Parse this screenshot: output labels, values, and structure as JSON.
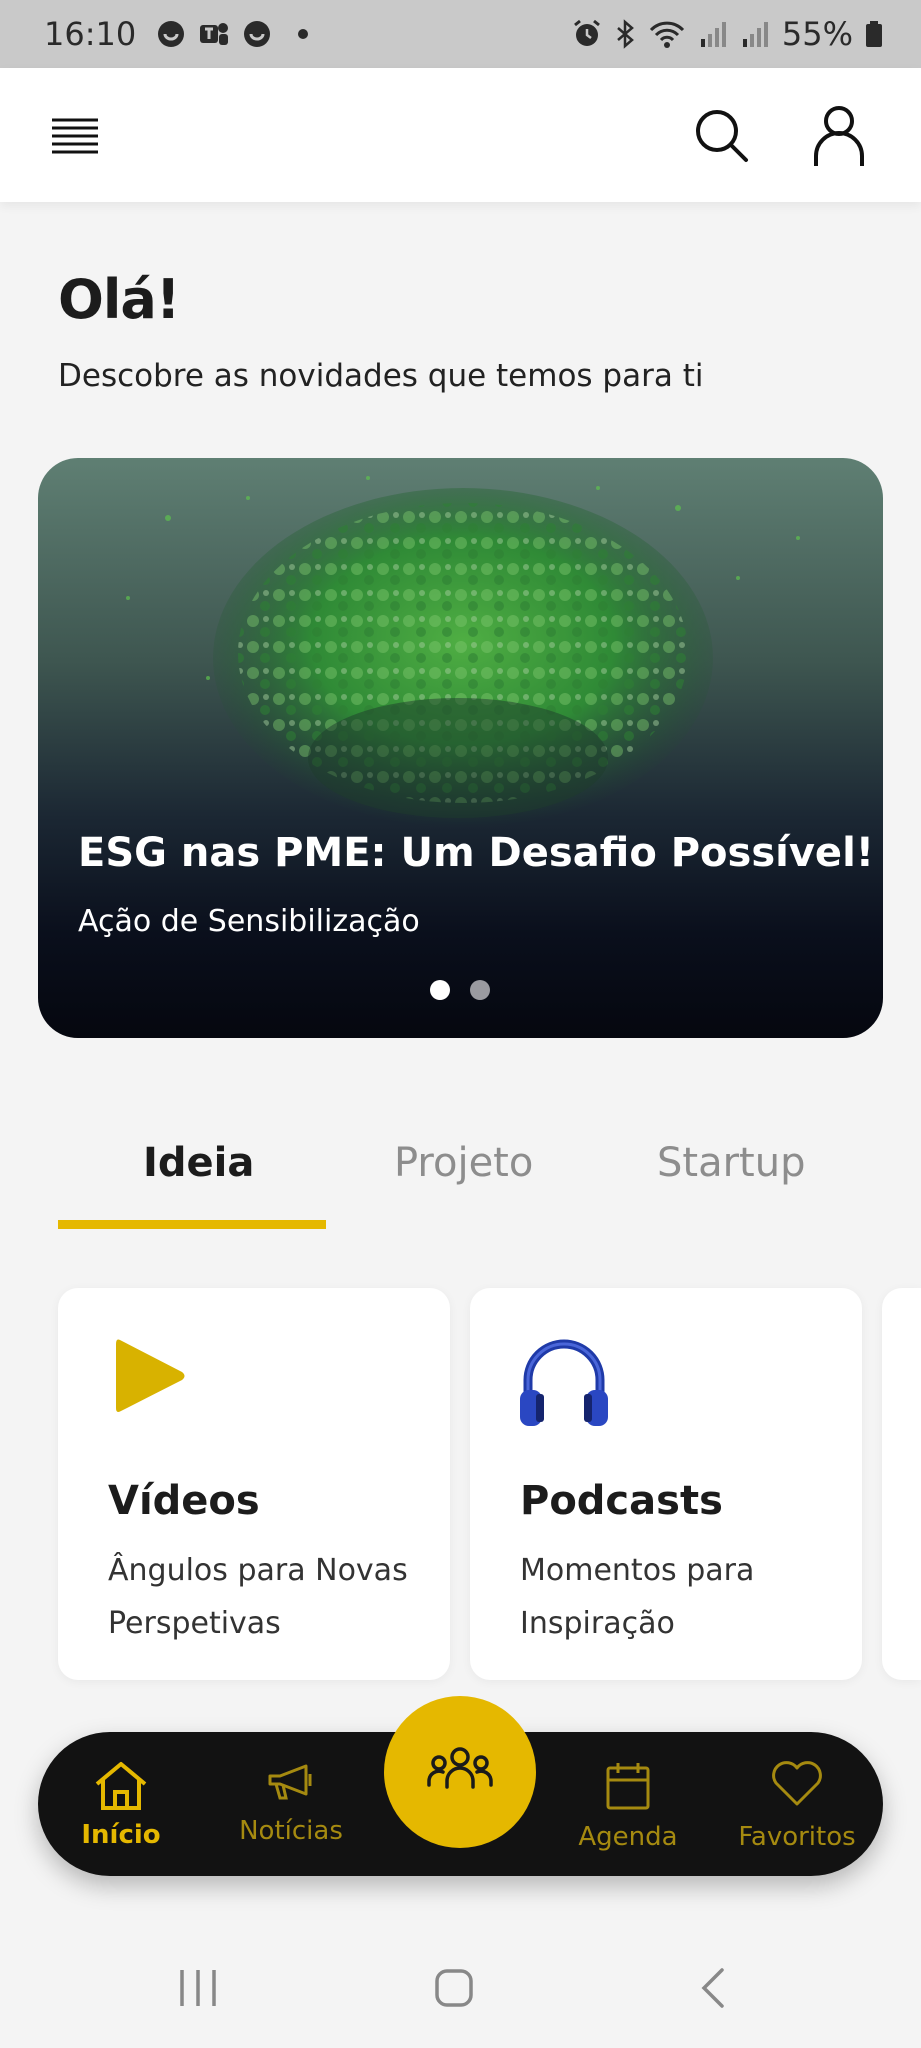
{
  "status_bar": {
    "time": "16:10",
    "battery": "55%",
    "icons": [
      "chat-bubble-icon",
      "teams-icon",
      "chat-bubble-icon",
      "alarm-icon",
      "bluetooth-icon",
      "wifi-icon",
      "signal-icon",
      "signal-icon",
      "battery-icon"
    ]
  },
  "header": {
    "icons": [
      "menu-icon",
      "search-icon",
      "user-icon"
    ]
  },
  "greeting": {
    "title": "Olá!",
    "subtitle": "Descobre as novidades que temos para ti"
  },
  "hero": {
    "title": "ESG nas PME: Um Desafio Possível!",
    "subtitle": "Ação de Sensibilização",
    "slide_count": 2,
    "active_slide": 1
  },
  "tabs": [
    {
      "label": "Ideia",
      "active": true
    },
    {
      "label": "Projeto",
      "active": false
    },
    {
      "label": "Startup",
      "active": false
    }
  ],
  "cards": [
    {
      "title": "Vídeos",
      "description": "Ângulos para Novas Perspetivas",
      "icon": "play-icon"
    },
    {
      "title": "Podcasts",
      "description": "Momentos para Inspiração",
      "icon": "headphones-icon"
    }
  ],
  "bottom_nav": {
    "items": [
      {
        "label": "Início",
        "icon": "home-icon",
        "active": true
      },
      {
        "label": "Notícias",
        "icon": "megaphone-icon",
        "active": false
      },
      {
        "label": "Agenda",
        "icon": "calendar-icon",
        "active": false
      },
      {
        "label": "Favoritos",
        "icon": "heart-icon",
        "active": false
      }
    ],
    "center_icon": "community-icon"
  },
  "colors": {
    "accent": "#e5b800",
    "nav_background": "#121212",
    "page_background": "#f4f4f4",
    "inactive_tab": "#8d8d8d"
  }
}
